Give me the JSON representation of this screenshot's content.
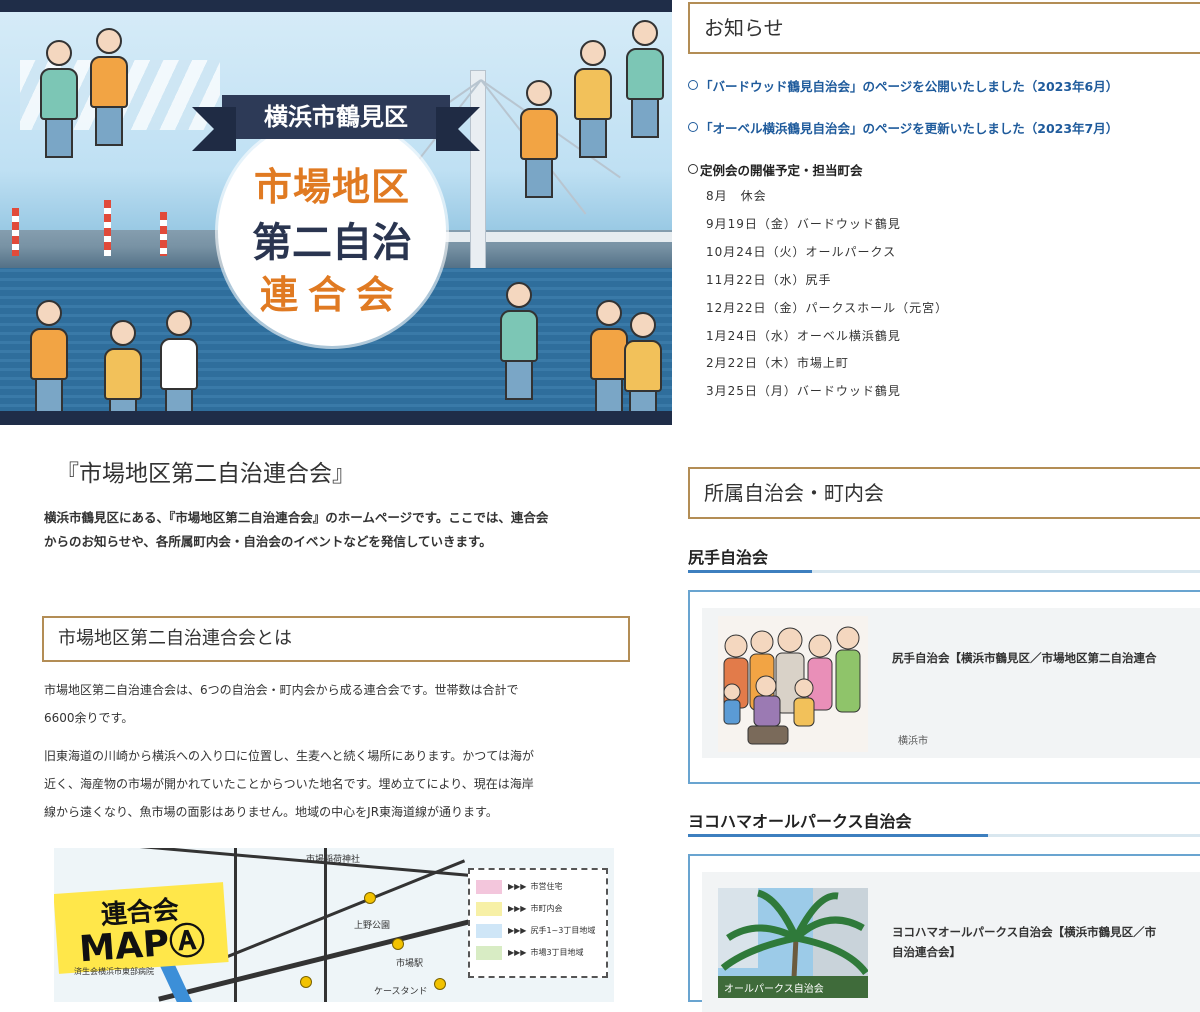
{
  "hero": {
    "ribbon": "横浜市鶴見区",
    "title_line1": "市場地区",
    "title_line2": "第二自治",
    "title_line3": "連合会"
  },
  "main": {
    "heading": "『市場地区第二自治連合会』",
    "intro_line1": "横浜市鶴見区にある、『市場地区第二自治連合会』のホームページです。ここでは、連合会",
    "intro_line2": "からのお知らせや、各所属町内会・自治会のイベントなどを発信していきます。",
    "about_heading": "市場地区第二自治連合会とは",
    "about_p1_line1": "市場地区第二自治連合会は、6つの自治会・町内会から成る連合会です。世帯数は合計で",
    "about_p1_line2": "6600余りです。",
    "about_p2_line1": "旧東海道の川崎から横浜への入り口に位置し、生麦へと続く場所にあります。かつては海が",
    "about_p2_line2": "近く、海産物の市場が開かれていたことからついた地名です。埋め立てにより、現在は海岸",
    "about_p2_line3": "線から遠くなり、魚市場の面影はありません。地域の中心をJR東海道線が通ります。"
  },
  "map": {
    "tag_line1": "連合会",
    "tag_line2": "MAP",
    "tag_circle": "Ⓐ",
    "legend": [
      {
        "label": "市営住宅",
        "color": "#f3c6dc"
      },
      {
        "label": "市町内会",
        "color": "#f7f0a6"
      },
      {
        "label": "尻手1~3丁目地域",
        "color": "#cfe6f7"
      },
      {
        "label": "市場3丁目地域",
        "color": "#d8ecc4"
      }
    ],
    "labels": [
      "市場稲荷神社",
      "ケースタンド",
      "市場駅",
      "済生会横浜市東部病院",
      "上野公園"
    ]
  },
  "news": {
    "title": "お知らせ",
    "items": [
      "「バードウッド鶴見自治会」のページを公開いたしました（2023年6月）",
      "「オーベル横浜鶴見自治会」のページを更新いたしました（2023年7月）"
    ],
    "schedule_title": "定例会の開催予定・担当町会",
    "schedule": [
      "8月　休会",
      "9月19日（金）バードウッド鶴見",
      "10月24日（火）オールパークス",
      "11月22日（水）尻手",
      "12月22日（金）パークスホール（元宮）",
      "1月24日（水）オーベル横浜鶴見",
      "2月22日（木）市場上町",
      "3月25日（月）バードウッド鶴見"
    ]
  },
  "members": {
    "title": "所属自治会・町内会",
    "groups": [
      {
        "name": "尻手自治会",
        "card_text_line1": "尻手自治会【横浜市鶴見区／市場地区第二自治連合",
        "card_text_line2": "",
        "card_small": "横浜市"
      },
      {
        "name": "ヨコハマオールパークス自治会",
        "card_text_line1": "ヨコハマオールパークス自治会【横浜市鶴見区／市",
        "card_text_line2": "自治連合会】",
        "card_small": "オールパークス自治会"
      }
    ]
  },
  "colors": {
    "navy": "#1f2d48",
    "orange": "#e07a22",
    "gold_border": "#b38d55",
    "link_blue": "#1f5b9c",
    "card_border": "#69a4d0"
  }
}
